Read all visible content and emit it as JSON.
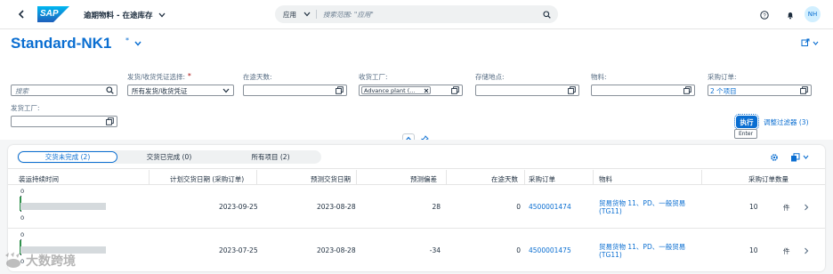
{
  "shell": {
    "back_icon": "chevron-left",
    "logo_text": "SAP",
    "app_title": "逾期物料 - 在途库存",
    "search_scope": "应用",
    "search_placeholder": "搜索范围: \"应用\"",
    "user_initials": "NH"
  },
  "header": {
    "variant_name": "Standard-NK1",
    "variant_modified_marker": "*"
  },
  "filters": {
    "search_placeholder": "搜索",
    "items": [
      {
        "label": "发货/收货凭证选择:",
        "required_marker": "*",
        "value": "所有发货/收货凭证"
      },
      {
        "label": "在途天数:",
        "value": ""
      },
      {
        "label": "收货工厂:",
        "token": "Advance plant (…"
      },
      {
        "label": "存储地点:",
        "value": ""
      },
      {
        "label": "物料:",
        "value": ""
      },
      {
        "label": "采购订单:",
        "value": "2 个项目"
      }
    ],
    "second_row_label": "发货工厂:",
    "go_label": "执行",
    "adapt_label": "调整过滤器 (3)",
    "tooltip": "Enter"
  },
  "tabs": [
    {
      "label": "交货未完成 (2)",
      "selected": true
    },
    {
      "label": "交货已完成 (0)",
      "selected": false
    },
    {
      "label": "所有项目 (2)",
      "selected": false
    }
  ],
  "table": {
    "columns": [
      "装运持续时间",
      "计划交货日期 (采购订单)",
      "预测交货日期",
      "预测偏差",
      "在途天数",
      "采购订单",
      "物料",
      "采购订单数量"
    ],
    "rows": [
      {
        "scale_top": "0",
        "scale_bottom": "0",
        "planned": "2023-09-25",
        "forecast": "2023-08-28",
        "deviation": "28",
        "days": "0",
        "po": "4500001474",
        "material_line1": "贸易货物 11、PD、一般贸易",
        "material_line2": "(TG11)",
        "qty": "10",
        "unit": "件"
      },
      {
        "scale_top": "0",
        "scale_bottom": "0",
        "planned": "2023-07-25",
        "forecast": "2023-08-28",
        "deviation": "-34",
        "days": "0",
        "po": "4500001475",
        "material_line1": "贸易货物 11、PD、一般贸易",
        "material_line2": "(TG11)",
        "qty": "10",
        "unit": "件"
      }
    ]
  },
  "watermark": "大数跨境",
  "colors": {
    "brand": "#0a6ed1",
    "title": "#0a6ed1",
    "text": "#1d2d3e"
  }
}
